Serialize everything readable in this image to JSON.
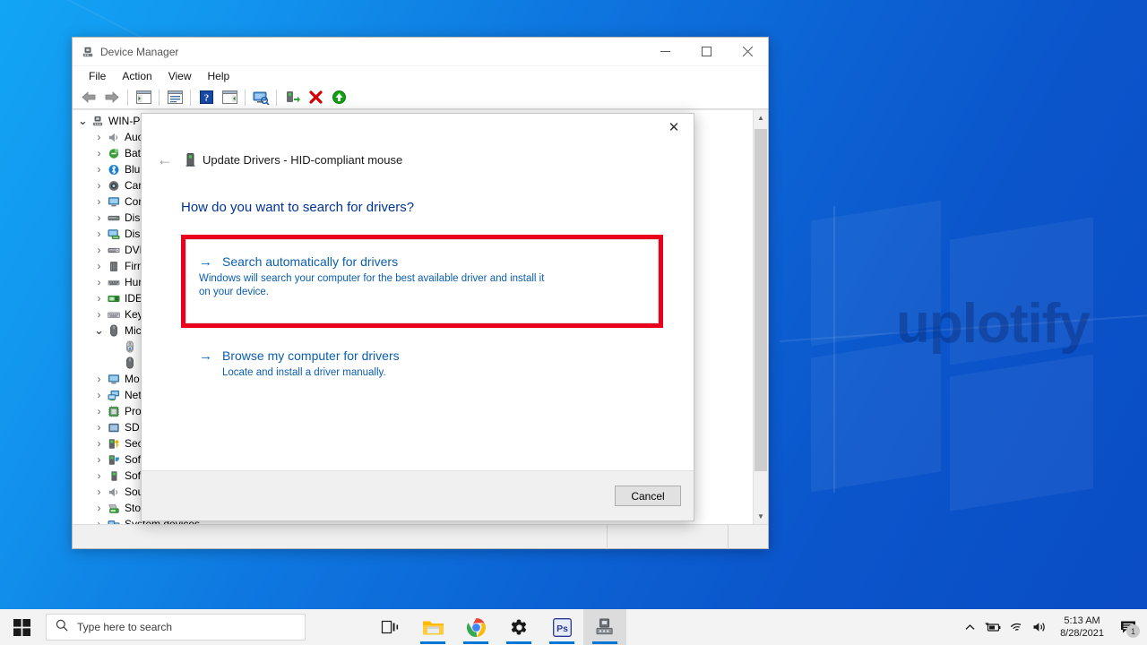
{
  "desktop": {
    "watermark": "uplotify"
  },
  "window": {
    "title": "Device Manager",
    "title_icon": "device-manager-icon",
    "controls": {
      "minimize": "—",
      "maximize": "☐",
      "close": "✕"
    },
    "menu": [
      {
        "label": "File"
      },
      {
        "label": "Action"
      },
      {
        "label": "View"
      },
      {
        "label": "Help"
      }
    ],
    "toolbar": [
      {
        "name": "back-arrow-icon",
        "tooltip": "Back"
      },
      {
        "name": "forward-arrow-icon",
        "tooltip": "Forward"
      },
      {
        "name": "separator"
      },
      {
        "name": "show-hide-console-tree-icon",
        "tooltip": "Show/Hide Console Tree"
      },
      {
        "name": "separator"
      },
      {
        "name": "properties-icon",
        "tooltip": "Properties"
      },
      {
        "name": "separator"
      },
      {
        "name": "help-icon",
        "tooltip": "Help"
      },
      {
        "name": "show-hide-action-pane-icon",
        "tooltip": "Show/Hide Action Pane"
      },
      {
        "name": "separator"
      },
      {
        "name": "scan-for-hardware-changes-icon",
        "tooltip": "Scan for hardware changes"
      },
      {
        "name": "separator"
      },
      {
        "name": "update-driver-icon",
        "tooltip": "Update driver"
      },
      {
        "name": "disable-device-icon",
        "tooltip": "Disable device"
      },
      {
        "name": "uninstall-device-icon",
        "tooltip": "Uninstall device"
      }
    ],
    "tree": [
      {
        "label": "WIN-PI",
        "icon": "computer-icon",
        "indent": 0,
        "twisty": "open"
      },
      {
        "label": "Auc",
        "icon": "audio-icon",
        "indent": 1,
        "twisty": "closed"
      },
      {
        "label": "Bat",
        "icon": "battery-icon",
        "indent": 1,
        "twisty": "closed"
      },
      {
        "label": "Blu",
        "icon": "bluetooth-icon",
        "indent": 1,
        "twisty": "closed"
      },
      {
        "label": "Car",
        "icon": "camera-icon",
        "indent": 1,
        "twisty": "closed"
      },
      {
        "label": "Cor",
        "icon": "computer-monitor-icon",
        "indent": 1,
        "twisty": "closed"
      },
      {
        "label": "Disl",
        "icon": "disk-drive-icon",
        "indent": 1,
        "twisty": "closed"
      },
      {
        "label": "Disp",
        "icon": "display-adapter-icon",
        "indent": 1,
        "twisty": "closed"
      },
      {
        "label": "DVD",
        "icon": "dvd-drive-icon",
        "indent": 1,
        "twisty": "closed"
      },
      {
        "label": "Firn",
        "icon": "firmware-icon",
        "indent": 1,
        "twisty": "closed"
      },
      {
        "label": "Hur",
        "icon": "human-interface-device-icon",
        "indent": 1,
        "twisty": "closed"
      },
      {
        "label": "IDE",
        "icon": "ide-controller-icon",
        "indent": 1,
        "twisty": "closed"
      },
      {
        "label": "Key",
        "icon": "keyboard-icon",
        "indent": 1,
        "twisty": "closed"
      },
      {
        "label": "Mic",
        "icon": "mouse-icon",
        "indent": 1,
        "twisty": "open"
      },
      {
        "label": "",
        "icon": "hid-mouse-icon",
        "indent": 2,
        "twisty": "none"
      },
      {
        "label": "",
        "icon": "mouse-device-icon",
        "indent": 2,
        "twisty": "none"
      },
      {
        "label": "Mo",
        "icon": "monitor-icon",
        "indent": 1,
        "twisty": "closed"
      },
      {
        "label": "Net",
        "icon": "network-adapter-icon",
        "indent": 1,
        "twisty": "closed"
      },
      {
        "label": "Pro",
        "icon": "processor-icon",
        "indent": 1,
        "twisty": "closed"
      },
      {
        "label": "SD",
        "icon": "sd-host-adapter-icon",
        "indent": 1,
        "twisty": "closed"
      },
      {
        "label": "Sec",
        "icon": "security-device-icon",
        "indent": 1,
        "twisty": "closed"
      },
      {
        "label": "Sof",
        "icon": "software-component-icon",
        "indent": 1,
        "twisty": "closed"
      },
      {
        "label": "Sof",
        "icon": "software-device-icon",
        "indent": 1,
        "twisty": "closed"
      },
      {
        "label": "Sou",
        "icon": "sound-device-icon",
        "indent": 1,
        "twisty": "closed"
      },
      {
        "label": "Sto",
        "icon": "storage-controller-icon",
        "indent": 1,
        "twisty": "closed"
      },
      {
        "label": "System devices",
        "icon": "system-device-icon",
        "indent": 1,
        "twisty": "closed"
      }
    ]
  },
  "dialog": {
    "close_label": "✕",
    "back_label": "←",
    "header_icon": "driver-device-icon",
    "header_title": "Update Drivers - HID-compliant mouse",
    "question": "How do you want to search for drivers?",
    "options": [
      {
        "arrow": "→",
        "title": "Search automatically for drivers",
        "description": "Windows will search your computer for the best available driver and install it on your device.",
        "highlighted": true
      },
      {
        "arrow": "→",
        "title": "Browse my computer for drivers",
        "description": "Locate and install a driver manually.",
        "highlighted": false
      }
    ],
    "cancel_label": "Cancel",
    "highlight_color": "#e8001c"
  },
  "taskbar": {
    "start_icon": "windows-start-icon",
    "search": {
      "icon": "search-icon",
      "placeholder": "Type here to search"
    },
    "apps": [
      {
        "name": "task-view-icon",
        "label": "Task View",
        "running": false
      },
      {
        "name": "file-explorer-icon",
        "label": "File Explorer",
        "running": true
      },
      {
        "name": "chrome-icon",
        "label": "Google Chrome",
        "running": true
      },
      {
        "name": "settings-icon",
        "label": "Settings",
        "running": true
      },
      {
        "name": "photoshop-icon",
        "label": "Adobe Photoshop",
        "running": true
      },
      {
        "name": "device-manager-taskbar-icon",
        "label": "Device Manager",
        "running": true
      }
    ],
    "tray": [
      {
        "name": "show-hidden-icons-chevron-icon"
      },
      {
        "name": "battery-icon"
      },
      {
        "name": "wifi-icon"
      },
      {
        "name": "volume-icon"
      }
    ],
    "clock": {
      "time": "5:13 AM",
      "date": "8/28/2021"
    },
    "action_center": {
      "icon": "action-center-icon",
      "badge": "1"
    }
  }
}
